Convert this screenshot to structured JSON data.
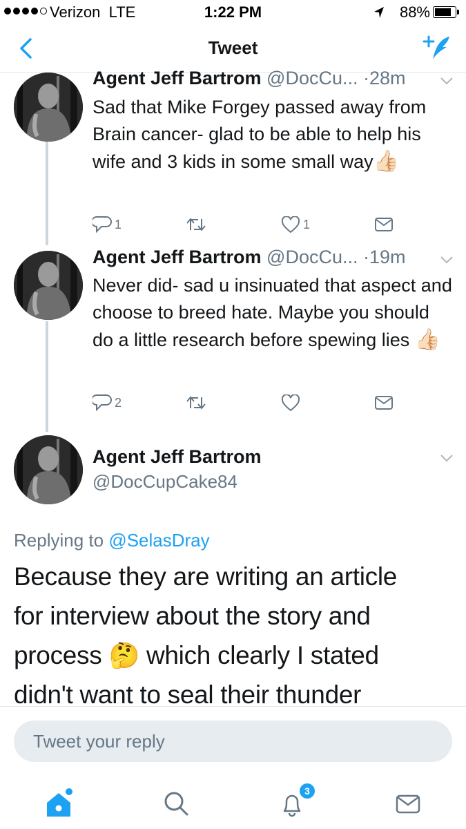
{
  "status_bar": {
    "carrier": "Verizon",
    "network": "LTE",
    "time": "1:22 PM",
    "battery_percent": "88%",
    "battery_level": 0.88,
    "signal_bars": 4
  },
  "nav": {
    "title": "Tweet",
    "back_icon": "chevron-left-icon",
    "compose_icon": "compose-tweet-icon"
  },
  "thread": [
    {
      "name": "Agent Jeff Bartrom",
      "handle": "@DocCu...",
      "time": "·28m",
      "text": "Sad that Mike Forgey passed away from Brain cancer- glad to be able to help his wife and 3 kids in some small way",
      "emoji": "👍🏻",
      "replies": "1",
      "retweets": "",
      "likes": "1"
    },
    {
      "name": "Agent Jeff Bartrom",
      "handle": "@DocCu...",
      "time": "·19m",
      "text": "Never did- sad u insinuated that aspect and choose to breed hate. Maybe you should do a little research before spewing lies",
      "emoji": "👍🏻",
      "replies": "2",
      "retweets": "",
      "likes": ""
    }
  ],
  "main_tweet": {
    "name": "Agent Jeff Bartrom",
    "handle": "@DocCupCake84",
    "replying_prefix": "Replying to ",
    "replying_to": "@SelasDray",
    "text_before_emoji": "Because they are writing an article for interview about the story and process ",
    "emoji": "🤔",
    "text_after_emoji": " which clearly I stated didn't want to seal their thunder"
  },
  "reply": {
    "placeholder": "Tweet your reply"
  },
  "tab_bar": {
    "notifications_badge": "3"
  },
  "colors": {
    "accent": "#1da1f2",
    "muted": "#657786",
    "divider": "#e1e8ed",
    "thread_line": "#ccd6dd"
  }
}
